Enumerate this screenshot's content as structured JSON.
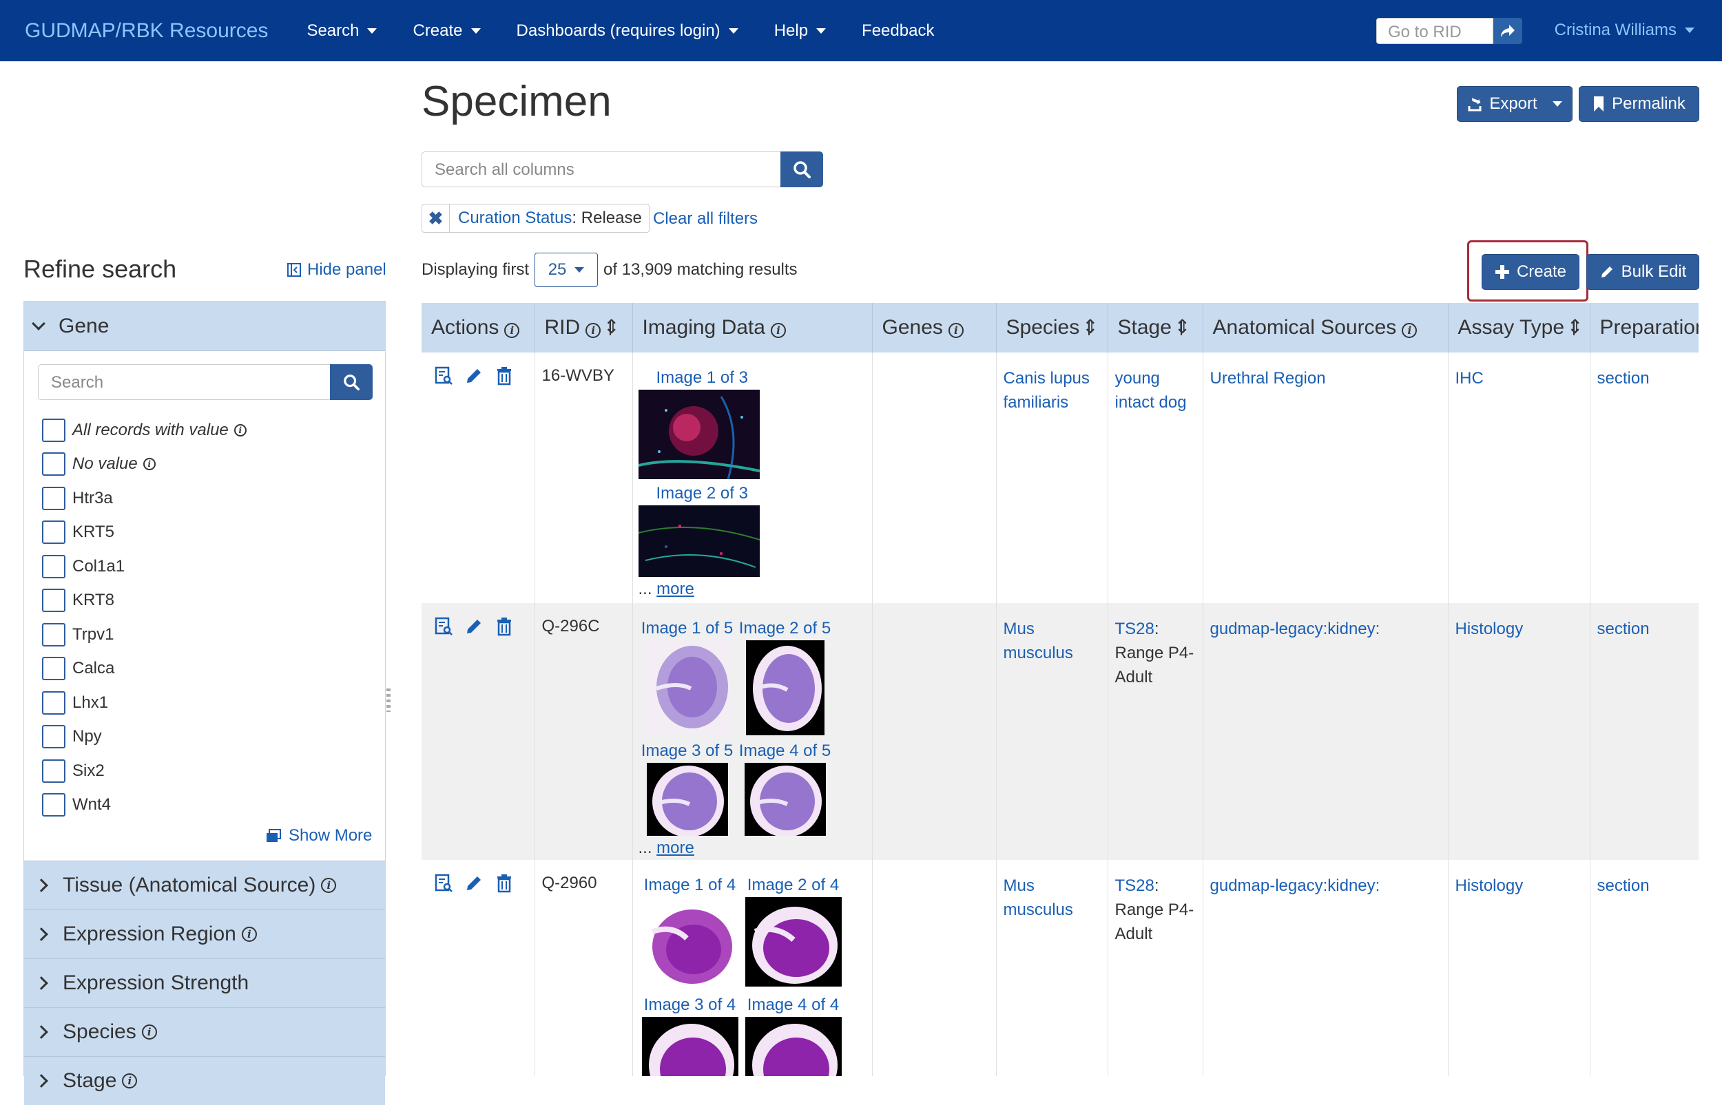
{
  "navbar": {
    "brand": "GUDMAP/RBK Resources",
    "items": [
      {
        "label": "Search",
        "dropdown": true
      },
      {
        "label": "Create",
        "dropdown": true
      },
      {
        "label": "Dashboards (requires login)",
        "dropdown": true
      },
      {
        "label": "Help",
        "dropdown": true
      },
      {
        "label": "Feedback",
        "dropdown": false
      }
    ],
    "goto_placeholder": "Go to RID",
    "user": "Cristina Williams"
  },
  "header": {
    "title": "Specimen",
    "export_label": "Export",
    "permalink_label": "Permalink",
    "search_placeholder": "Search all columns",
    "filter": {
      "field": "Curation Status",
      "value": ": Release"
    },
    "clear_filters": "Clear all filters",
    "displaying_prefix": "Displaying first",
    "page_size": "25",
    "displaying_suffix": "of 13,909 matching results",
    "create_label": "Create",
    "bulk_edit_label": "Bulk Edit"
  },
  "sidebar": {
    "title": "Refine search",
    "hide_panel": "Hide panel",
    "open_facet": "Gene",
    "search_placeholder": "Search",
    "options": [
      {
        "label": "All records with value",
        "italic": true,
        "info": true
      },
      {
        "label": "No value",
        "italic": true,
        "info": true
      },
      {
        "label": "Htr3a"
      },
      {
        "label": "KRT5"
      },
      {
        "label": "Col1a1"
      },
      {
        "label": "KRT8"
      },
      {
        "label": "Trpv1"
      },
      {
        "label": "Calca"
      },
      {
        "label": "Lhx1"
      },
      {
        "label": "Npy"
      },
      {
        "label": "Six2"
      },
      {
        "label": "Wnt4"
      }
    ],
    "show_more": "Show More",
    "collapsed_facets": [
      {
        "label": "Tissue (Anatomical Source)",
        "info": true
      },
      {
        "label": "Expression Region",
        "info": true
      },
      {
        "label": "Expression Strength",
        "info": false
      },
      {
        "label": "Species",
        "info": true
      },
      {
        "label": "Stage",
        "info": true
      }
    ]
  },
  "table": {
    "columns": [
      "Actions",
      "RID",
      "Imaging Data",
      "Genes",
      "Species",
      "Stage",
      "Anatomical Sources",
      "Assay Type",
      "Preparation"
    ],
    "rows": [
      {
        "rid": "16-WVBY",
        "images": [
          "Image 1 of 3",
          "Image 2 of 3"
        ],
        "more_prefix": "... ",
        "more": "more",
        "genes": "",
        "species": "Canis lupus familiaris",
        "stage_link": "young intact dog",
        "stage_text": "",
        "anatomical": "Urethral Region",
        "assay": "IHC",
        "prep": "section"
      },
      {
        "rid": "Q-296C",
        "images": [
          "Image 1 of 5",
          "Image 2 of 5",
          "Image 3 of 5",
          "Image 4 of 5"
        ],
        "more_prefix": "... ",
        "more": "more",
        "genes": "",
        "species": "Mus musculus",
        "stage_link": "TS28",
        "stage_text": ": Range P4-Adult",
        "anatomical": "gudmap-legacy:kidney:",
        "assay": "Histology",
        "prep": "section"
      },
      {
        "rid": "Q-2960",
        "images": [
          "Image 1 of 4",
          "Image 2 of 4",
          "Image 3 of 4",
          "Image 4 of 4"
        ],
        "more_prefix": "",
        "more": "",
        "genes": "",
        "species": "Mus musculus",
        "stage_link": "TS28",
        "stage_text": ": Range P4-Adult",
        "anatomical": "gudmap-legacy:kidney:",
        "assay": "Histology",
        "prep": "section"
      }
    ]
  }
}
